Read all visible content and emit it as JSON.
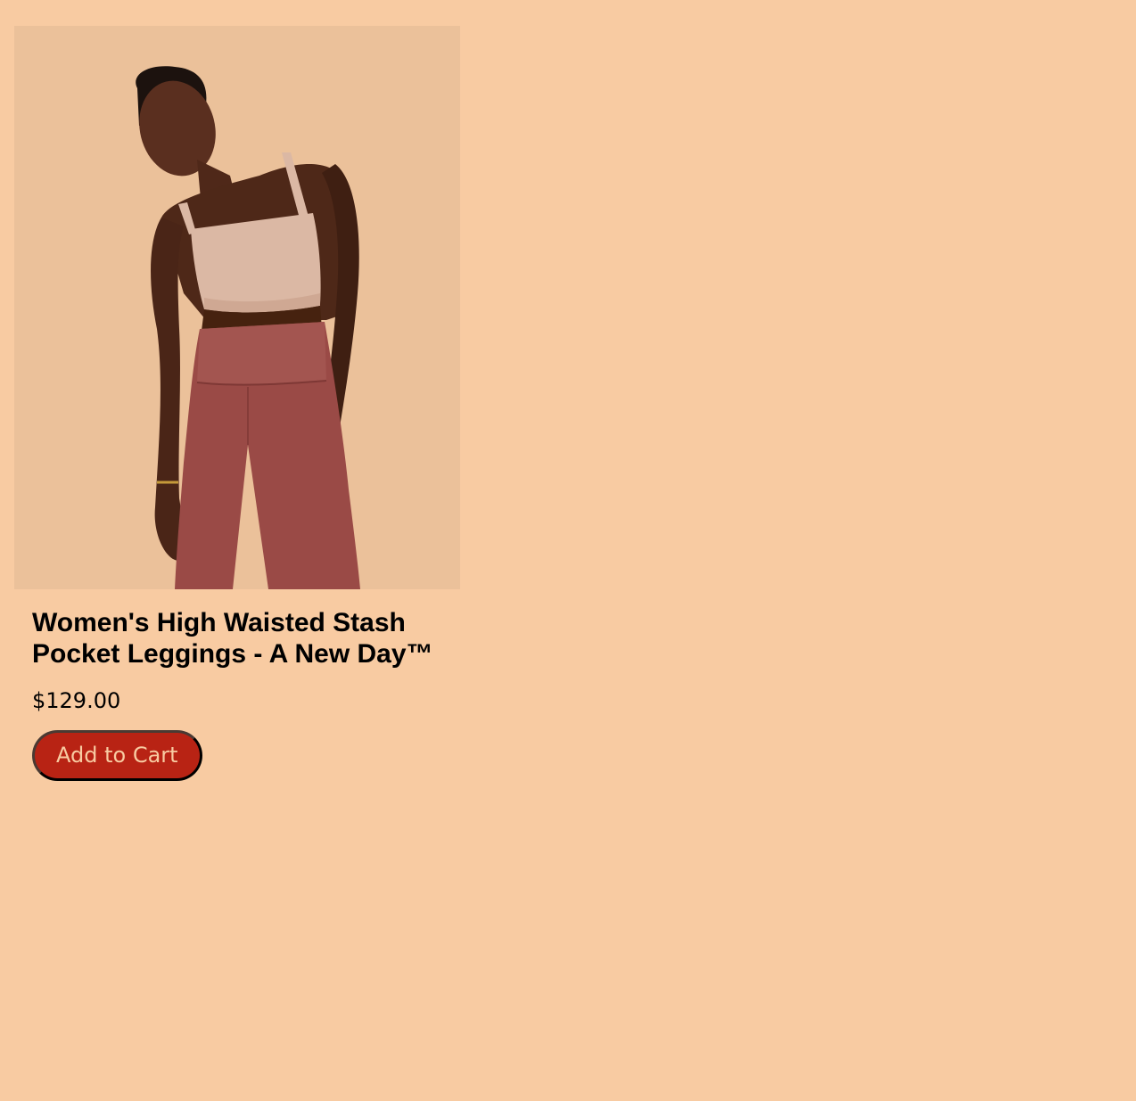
{
  "page": {
    "background_color": "#f8cba2"
  },
  "product": {
    "image_alt": "Model wearing a beige crop top and rust-colored high waisted leggings",
    "title": "Women's High Waisted Stash Pocket Leggings - A New Day™",
    "price": "$129.00",
    "add_to_cart_label": "Add to Cart",
    "colors": {
      "image_background": "#ebc19a",
      "button_background": "#b82314",
      "button_text": "#f8cba2",
      "legging_color": "#9a4a46",
      "top_color": "#dbb8a4"
    }
  }
}
